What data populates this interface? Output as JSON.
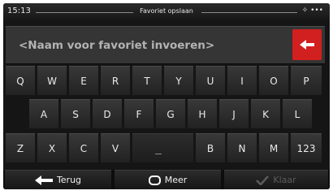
{
  "status": {
    "time": "15:13",
    "title": "Favoriet opslaan"
  },
  "input": {
    "placeholder": "<Naam voor favoriet invoeren>",
    "value": ""
  },
  "keyboard": {
    "row1": [
      "Q",
      "W",
      "E",
      "R",
      "T",
      "Y",
      "U",
      "I",
      "O",
      "P"
    ],
    "row2": [
      "A",
      "S",
      "D",
      "F",
      "G",
      "H",
      "J",
      "K",
      "L"
    ],
    "row3_left": [
      "Z",
      "X",
      "C",
      "V"
    ],
    "row3_right": [
      "B",
      "N",
      "M"
    ],
    "numbers_key": "123"
  },
  "toolbar": {
    "back_label": "Terug",
    "more_label": "Meer",
    "done_label": "Klaar"
  },
  "colors": {
    "accent": "#d21f1f",
    "background": "#151515",
    "key": "#2d2d2d"
  },
  "icons": {
    "backspace": "backspace-arrow-icon",
    "back": "arrow-left-icon",
    "more": "rounded-square-icon",
    "done": "checkmark-icon",
    "gps": "satellite-icon",
    "menu": "dots-icon"
  }
}
